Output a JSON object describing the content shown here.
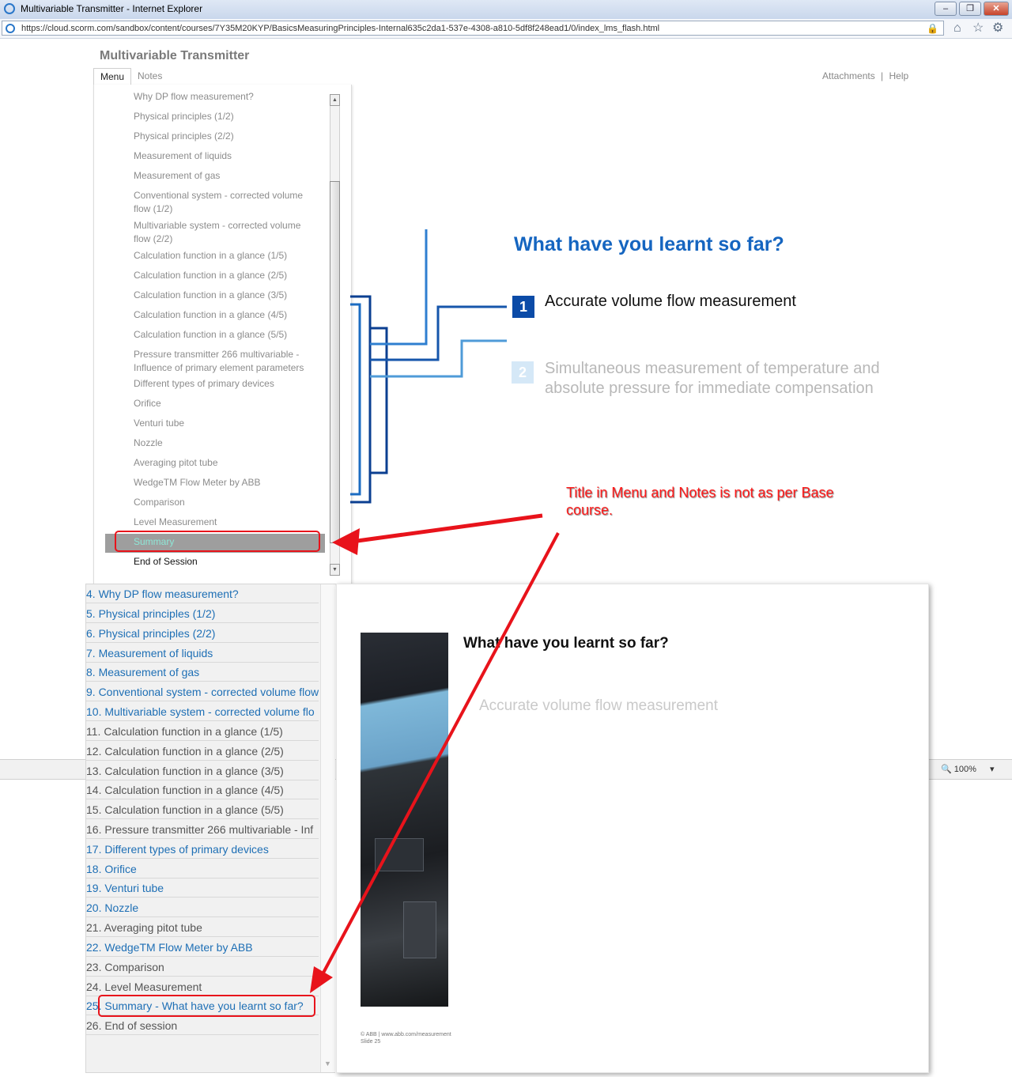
{
  "browser": {
    "window_title": "Multivariable Transmitter - Internet Explorer",
    "url": "https://cloud.scorm.com/sandbox/content/courses/7Y35M20KYP/BasicsMeasuringPrinciples-Internal635c2da1-537e-4308-a810-5df8f248ead1/0/index_lms_flash.html",
    "zoom": "100%",
    "icons": [
      "ie-logo-icon",
      "lock-icon",
      "home-icon",
      "star-icon",
      "gear-icon"
    ]
  },
  "player": {
    "course_title": "Multivariable Transmitter",
    "tabs": {
      "menu": "Menu",
      "notes": "Notes"
    },
    "links": {
      "attachments": "Attachments",
      "separator": "|",
      "help": "Help"
    },
    "menu_items": [
      "Why DP flow measurement?",
      "Physical principles (1/2)",
      "Physical principles (2/2)",
      "Measurement of liquids",
      "Measurement of gas",
      "Conventional system - corrected volume flow (1/2)",
      "Multivariable system - corrected volume flow (2/2)",
      "Calculation function in a glance (1/5)",
      "Calculation function in a glance (2/5)",
      "Calculation function in a glance (3/5)",
      "Calculation function in a glance (4/5)",
      "Calculation function in a glance (5/5)",
      "Pressure transmitter 266 multivariable - Influence of primary element parameters",
      "Different types of primary devices",
      "Orifice",
      "Venturi tube",
      "Nozzle",
      "Averaging pitot tube",
      "WedgeTM Flow Meter by ABB",
      "Comparison",
      "Level Measurement",
      "Summary",
      "End of Session"
    ],
    "selected_item": "Summary"
  },
  "slide": {
    "title": "What have you learnt so far?",
    "points": [
      {
        "num": "1",
        "text": "Accurate volume flow measurement"
      },
      {
        "num": "2",
        "text": "Simultaneous measurement of temperature and absolute pressure for immediate compensation"
      }
    ],
    "colors": {
      "title": "#1565c0",
      "box_active": "#0b4ba7",
      "box_inactive": "#d5e8f7"
    }
  },
  "annotation": {
    "text": "Title in Menu and Notes is not as per Base course.",
    "color": "#ff1a1a"
  },
  "base_course": {
    "menu_items": [
      {
        "label": "4. Why DP flow measurement?",
        "visited": true
      },
      {
        "label": "5. Physical principles (1/2)",
        "visited": true
      },
      {
        "label": "6. Physical principles (2/2)",
        "visited": true
      },
      {
        "label": "7. Measurement of liquids",
        "visited": true
      },
      {
        "label": "8. Measurement of gas",
        "visited": true
      },
      {
        "label": "9. Conventional system - corrected volume flow",
        "visited": true
      },
      {
        "label": "10. Multivariable system - corrected volume flo",
        "visited": true
      },
      {
        "label": "11. Calculation function in a glance (1/5)",
        "visited": false
      },
      {
        "label": "12. Calculation function in a glance (2/5)",
        "visited": false
      },
      {
        "label": "13. Calculation function in a glance (3/5)",
        "visited": false
      },
      {
        "label": "14. Calculation function in a glance (4/5)",
        "visited": false
      },
      {
        "label": "15. Calculation function in a glance (5/5)",
        "visited": false
      },
      {
        "label": "16. Pressure transmitter 266 multivariable - Inf",
        "visited": false
      },
      {
        "label": "17. Different types of primary devices",
        "visited": true
      },
      {
        "label": "18. Orifice",
        "visited": true
      },
      {
        "label": "19. Venturi tube",
        "visited": true
      },
      {
        "label": "20. Nozzle",
        "visited": true
      },
      {
        "label": "21. Averaging pitot tube",
        "visited": false
      },
      {
        "label": "22. WedgeTM Flow Meter by ABB",
        "visited": true
      },
      {
        "label": "23. Comparison",
        "visited": false
      },
      {
        "label": "24. Level Measurement",
        "visited": false
      },
      {
        "label": "25. Summary - What have you learnt so far?",
        "visited": true
      },
      {
        "label": "26. End of session",
        "visited": false
      }
    ],
    "slide_title": "What have you learnt so far?",
    "slide_point": "Accurate volume flow measurement",
    "footer_line1": "© ABB  | www.abb.com/measurement",
    "footer_line2": "Slide 25"
  }
}
